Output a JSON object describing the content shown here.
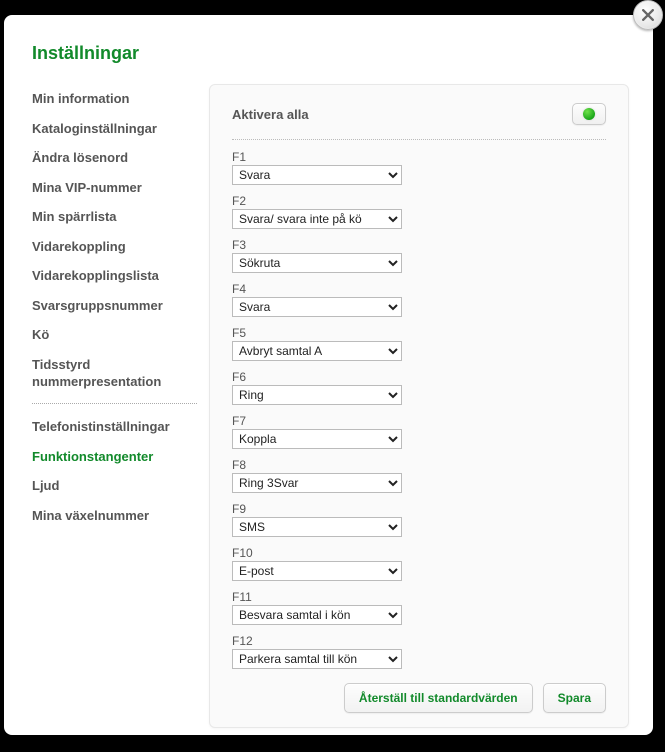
{
  "page_title": "Inställningar",
  "close_label": "Close",
  "sidebar": {
    "group1": [
      "Min information",
      "Kataloginställningar",
      "Ändra lösenord",
      "Mina VIP-nummer",
      "Min spärrlista",
      "Vidarekoppling",
      "Vidarekopplingslista",
      "Svarsgruppsnummer",
      "Kö",
      "Tidsstyrd nummerpresentation"
    ],
    "group2": [
      "Telefonistinställningar",
      "Funktionstangenter",
      "Ljud",
      "Mina växelnummer"
    ],
    "active": "Funktionstangenter"
  },
  "panel": {
    "activate_all_label": "Aktivera alla",
    "toggle_state": "on",
    "fields": [
      {
        "key": "F1",
        "value": "Svara"
      },
      {
        "key": "F2",
        "value": "Svara/ svara inte på kö"
      },
      {
        "key": "F3",
        "value": "Sökruta"
      },
      {
        "key": "F4",
        "value": "Svara"
      },
      {
        "key": "F5",
        "value": "Avbryt samtal A"
      },
      {
        "key": "F6",
        "value": "Ring"
      },
      {
        "key": "F7",
        "value": "Koppla"
      },
      {
        "key": "F8",
        "value": "Ring 3Svar"
      },
      {
        "key": "F9",
        "value": "SMS"
      },
      {
        "key": "F10",
        "value": "E-post"
      },
      {
        "key": "F11",
        "value": "Besvara samtal i kön"
      },
      {
        "key": "F12",
        "value": "Parkera samtal till kön"
      }
    ],
    "reset_label": "Återställ till standardvärden",
    "save_label": "Spara"
  }
}
